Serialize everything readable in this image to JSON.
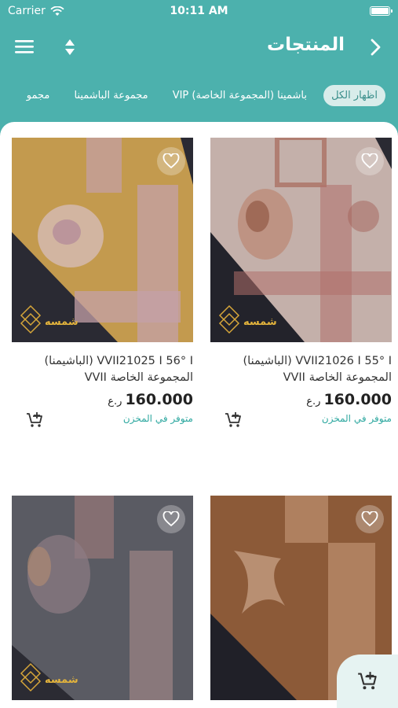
{
  "status_bar": {
    "carrier": "Carrier",
    "time": "10:11 AM"
  },
  "nav": {
    "title": "المنتجات",
    "icons": [
      "menu-icon",
      "sort-icon",
      "chevron-right-icon"
    ]
  },
  "tabs": [
    {
      "label": "اظهار الكل"
    },
    {
      "label": "باشمينا (المجموعة الخاصة) VIP"
    },
    {
      "label": "مجموعة الباشمينا"
    },
    {
      "label": "مجمو"
    }
  ],
  "products": [
    {
      "name": "VVII21026 I 55° I (الباشيمنا) المجموعة الخاصة VVII",
      "price": "160.000",
      "currency": "ر.ع",
      "stock": "متوفر في المخزن",
      "colors": {
        "base": "#c8b6b0",
        "corner": "#23232b",
        "border": "#b0706a"
      }
    },
    {
      "name": "VVII21025 I 56° I (الباشيمنا) المجموعة الخاصة VVII",
      "price": "160.000",
      "currency": "ر.ع",
      "stock": "متوفر في المخزن",
      "colors": {
        "base": "#c39a4e",
        "corner": "#2a2a33",
        "border": "#c4a0a8"
      }
    },
    {
      "colors": {
        "base": "#8c5a38",
        "corner": "#202028",
        "border": "#c79a7a"
      }
    },
    {
      "colors": {
        "base": "#5a5b63",
        "corner": "#2b2b33",
        "border": "#b09090"
      }
    }
  ],
  "colors": {
    "accent": "#4cb1ad",
    "stock_text": "#2ea8a0"
  }
}
